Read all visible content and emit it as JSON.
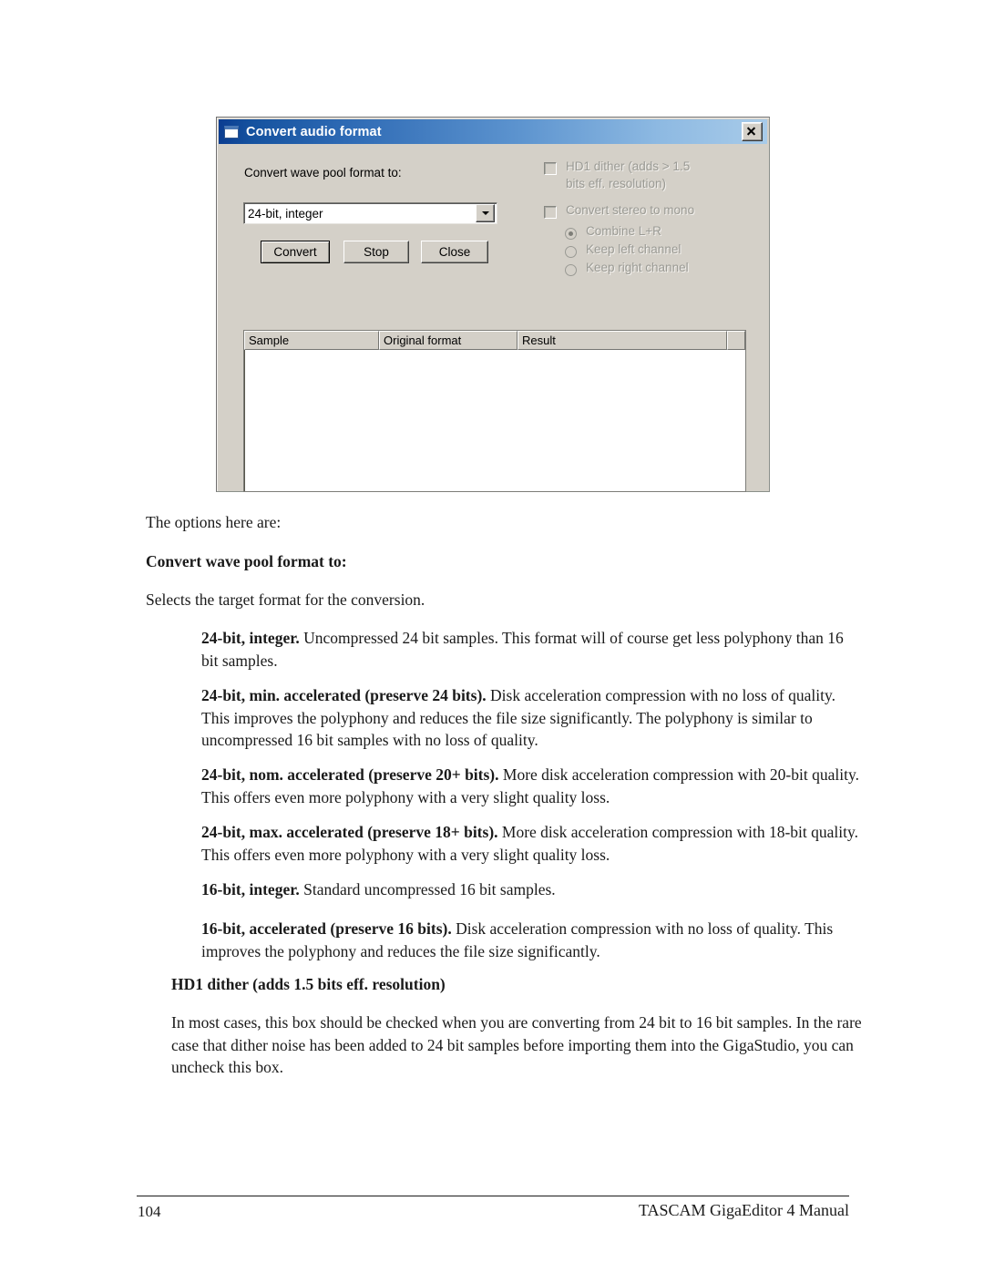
{
  "page": {
    "number": "104",
    "manual_title": "TASCAM GigaEditor 4 Manual"
  },
  "dialog": {
    "title": "Convert audio format",
    "icon": "window-icon",
    "close_label": "Close window",
    "format_label": "Convert wave pool format to:",
    "format_value": "24-bit, integer",
    "buttons": {
      "convert": "Convert",
      "stop": "Stop",
      "close": "Close"
    },
    "options": {
      "hd1_dither_line1": "HD1 dither (adds > 1.5",
      "hd1_dither_line2": "bits eff. resolution)",
      "stereo_to_mono": "Convert stereo to mono",
      "radio_combine": "Combine L+R",
      "radio_keep_left": "Keep left channel",
      "radio_keep_right": "Keep right channel"
    },
    "list": {
      "columns": [
        "Sample",
        "Original format",
        "Result",
        ""
      ],
      "rows": []
    }
  },
  "body": {
    "intro": "The options here are:",
    "heading_convert": "Convert wave pool format to:",
    "intro2": "Selects the target format for the conversion.",
    "items": [
      {
        "term": "24-bit, integer.",
        "text": " Uncompressed 24 bit samples. This format will of course get less polyphony than 16 bit samples."
      },
      {
        "term": "24-bit, min. accelerated (preserve 24 bits).",
        "text": " Disk acceleration compression with no loss of quality. This improves the polyphony and reduces the file size significantly. The polyphony is similar to uncompressed 16 bit samples with no loss of quality."
      },
      {
        "term": "24-bit, nom. accelerated (preserve 20+ bits).",
        "text": " More disk acceleration compression with 20-bit quality. This offers even more polyphony with a very slight quality loss."
      },
      {
        "term": "24-bit, max. accelerated (preserve 18+ bits).",
        "text": " More disk acceleration compression with 18-bit quality. This offers even more polyphony with a very slight quality loss."
      },
      {
        "term": "16-bit, integer.",
        "text": " Standard uncompressed 16 bit samples."
      },
      {
        "term": "16-bit, accelerated (preserve 16 bits).",
        "text": " Disk acceleration compression with no loss of quality. This improves the polyphony and reduces the file size significantly."
      }
    ],
    "heading_hd1": "HD1 dither (adds 1.5 bits eff. resolution)",
    "hd1_paragraph": "In most cases, this box should be checked when you are converting from 24 bit to 16 bit samples. In the rare case that dither noise has been added to 24 bit samples before importing them into the GigaStudio, you can uncheck this box."
  }
}
